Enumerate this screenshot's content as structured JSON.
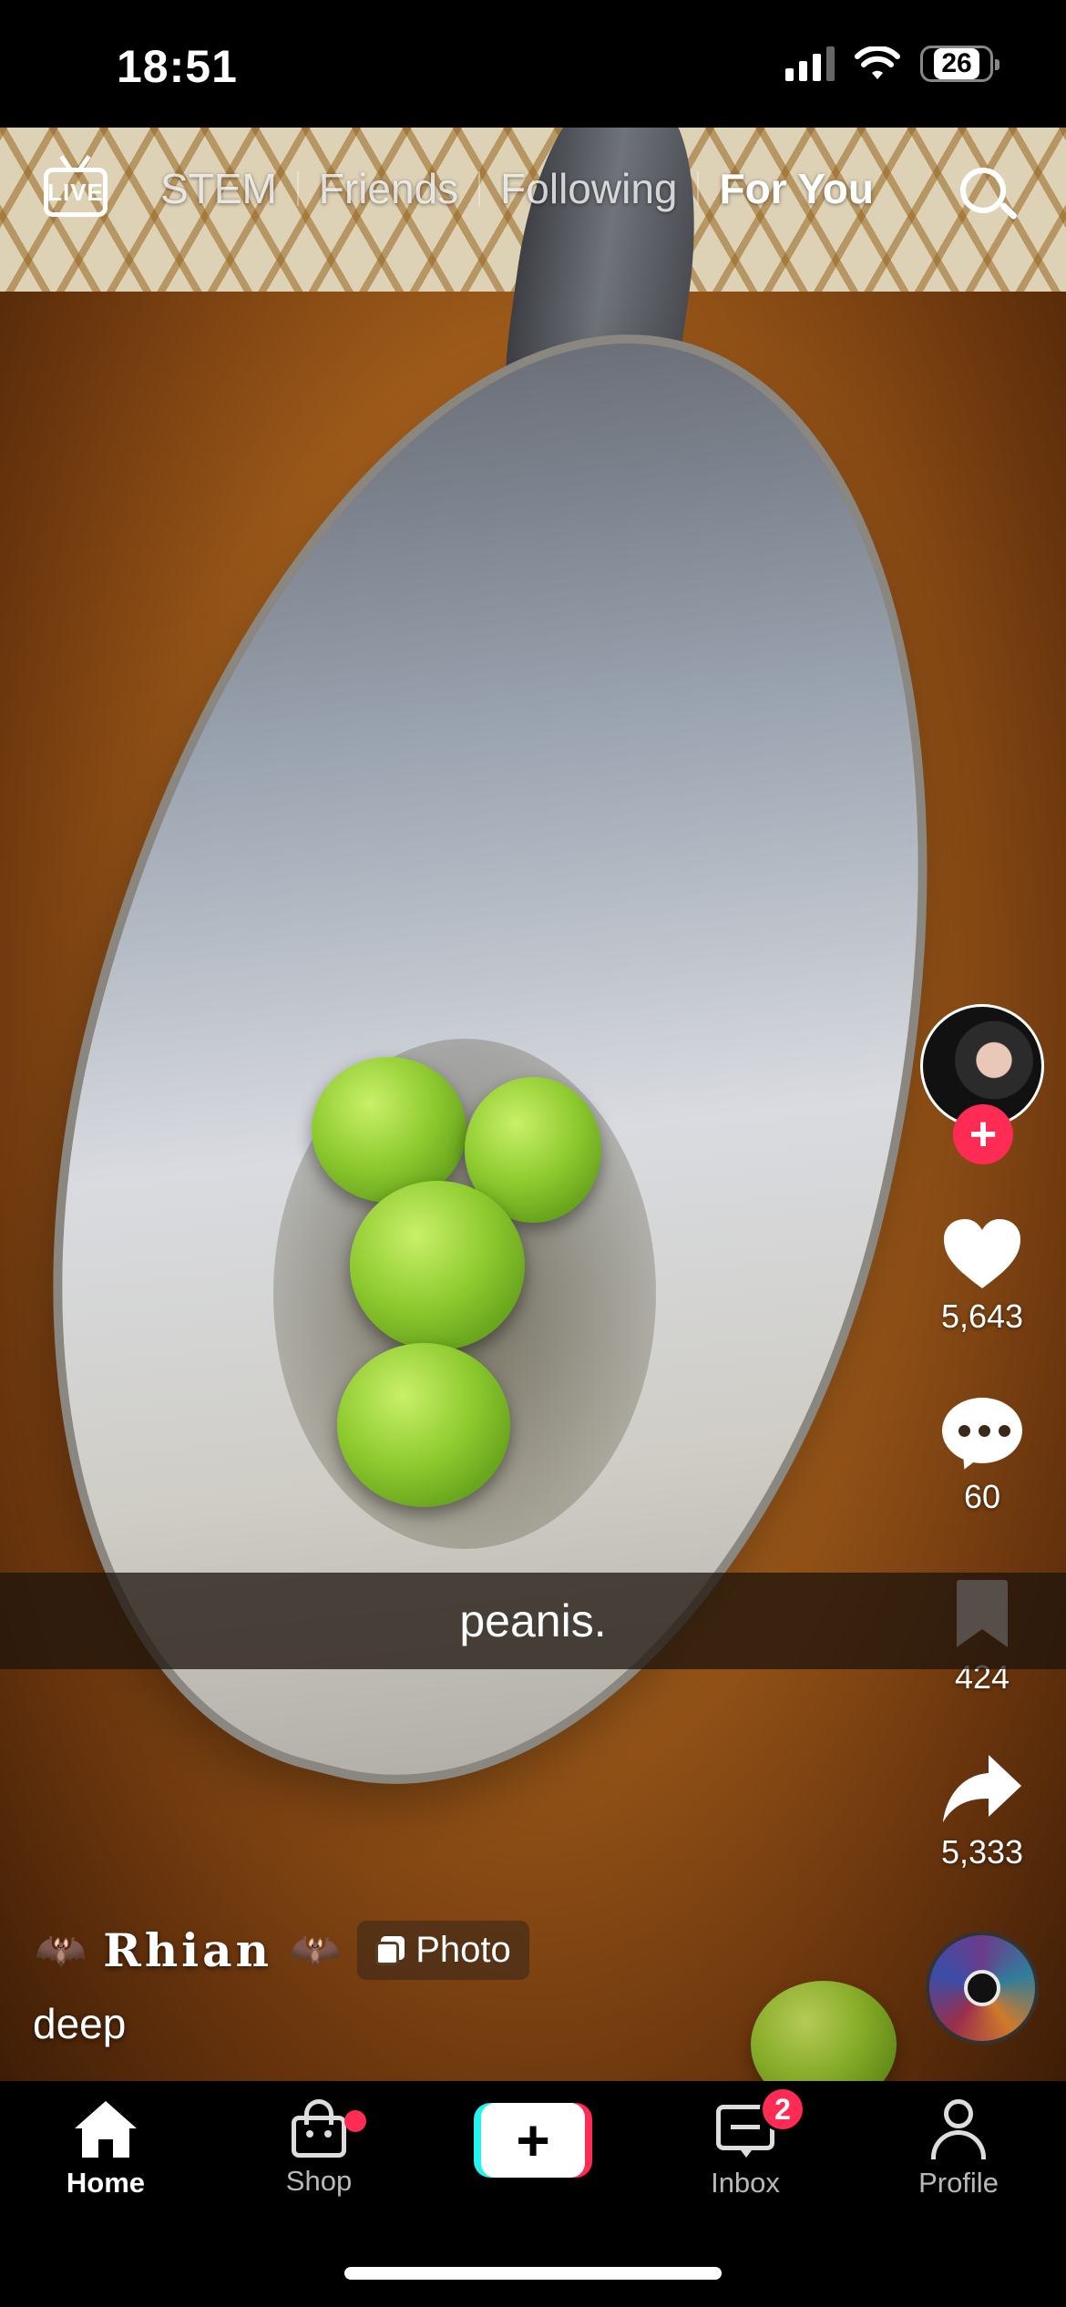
{
  "status_bar": {
    "time": "18:51",
    "battery": "26"
  },
  "top_nav": {
    "live_label": "LIVE",
    "tabs": [
      "STEM",
      "Friends",
      "Following",
      "For You"
    ],
    "active_tab": "For You"
  },
  "post": {
    "caption_overlay": "peanis.",
    "author": "Rhian",
    "author_decoration": "🦇",
    "media_type_label": "Photo",
    "description": "deep"
  },
  "actions": {
    "likes": "5,643",
    "comments": "60",
    "bookmarks": "424",
    "shares": "5,333"
  },
  "bottom_nav": {
    "home": "Home",
    "shop": "Shop",
    "inbox": "Inbox",
    "inbox_badge": "2",
    "profile": "Profile"
  },
  "colors": {
    "accent": "#fe2c55",
    "cyan": "#25f4ee",
    "background": "#000000"
  },
  "icons": [
    "live-icon",
    "search-icon",
    "heart-icon",
    "comment-icon",
    "bookmark-icon",
    "share-icon",
    "home-icon",
    "shop-icon",
    "create-icon",
    "inbox-icon",
    "profile-icon"
  ]
}
